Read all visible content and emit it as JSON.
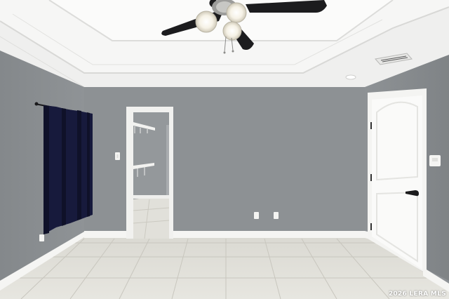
{
  "photo": {
    "watermark": "2026 LERA MLS"
  },
  "colors": {
    "wall": "#8d9194",
    "ceiling": "#f3f3f2",
    "trim": "#f5f5f3",
    "floor_tile": "#e3e2dc",
    "curtain": "#15183a",
    "fan_blade": "#1d1d1f"
  },
  "icons": [
    "ceiling-fan-icon",
    "door-handle-icon",
    "air-vent-icon",
    "smoke-detector-icon",
    "outlet-icon",
    "light-switch-icon"
  ]
}
